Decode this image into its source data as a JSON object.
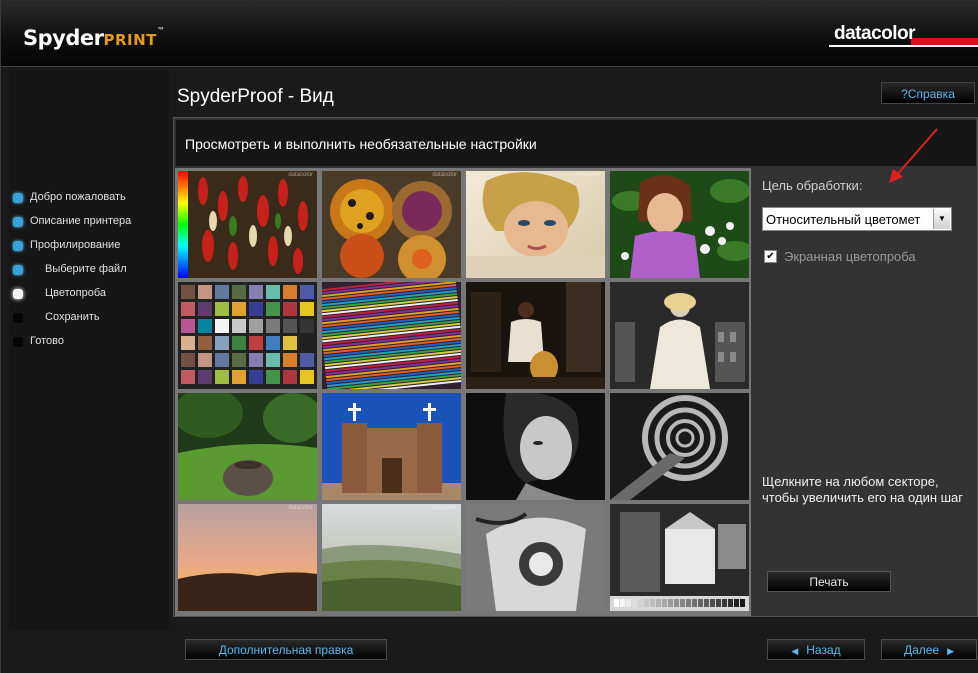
{
  "brand": {
    "product_a": "Spyder",
    "product_b": "PRINT",
    "tm": "™",
    "company": "datacolor",
    "accent": "#d8101e"
  },
  "sidebar": {
    "steps": [
      {
        "label": "Добро пожаловать",
        "state": "done"
      },
      {
        "label": "Описание принтера",
        "state": "done"
      },
      {
        "label": "Профилирование",
        "state": "done"
      },
      {
        "label": "Выберите файл",
        "state": "done"
      },
      {
        "label": "Цветопроба",
        "state": "current"
      },
      {
        "label": "Сохранить",
        "state": "pending"
      },
      {
        "label": "Готово",
        "state": "pending"
      }
    ]
  },
  "header": {
    "title": "SpyderProof - Вид",
    "help_label": "Справка",
    "help_icon": "help-icon"
  },
  "panel": {
    "subtitle": "Просмотреть и выполнить необязательные настройки",
    "watermark": "datacolor"
  },
  "controls": {
    "intent_label": "Цель обработки:",
    "intent_value": "Относительный цветомет",
    "softproof_label": "Экранная цветопроба",
    "softproof_checked": true,
    "hint": "Щелкните на любом секторе, чтобы увеличить его на один шаг",
    "print_label": "Печать"
  },
  "footer": {
    "extra_label": "Дополнительная правка",
    "back_label": "Назад",
    "next_label": "Далее"
  },
  "colors": {
    "link": "#5fb6ea",
    "step_dot": "#2e8fc0",
    "annotation_arrow": "#e02020"
  }
}
